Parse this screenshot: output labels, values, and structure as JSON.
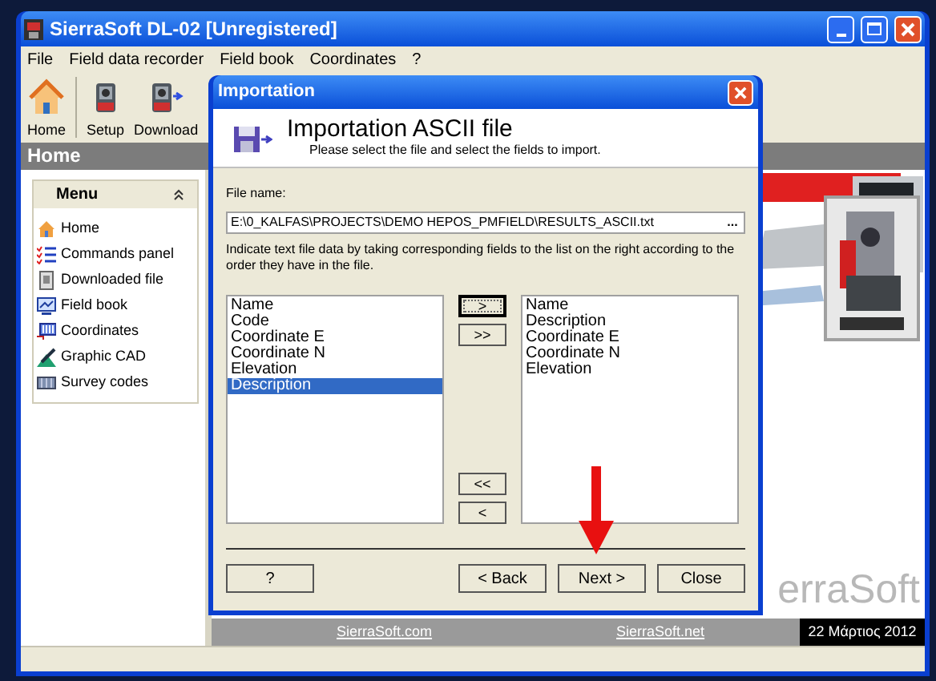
{
  "window": {
    "title": "SierraSoft DL-02 [Unregistered]"
  },
  "menu_bar": [
    "File",
    "Field data recorder",
    "Field book",
    "Coordinates",
    "?"
  ],
  "toolbar": [
    {
      "label": "Home",
      "kind": "home"
    },
    {
      "label": "Setup",
      "kind": "instrument"
    },
    {
      "label": "Download",
      "kind": "download"
    }
  ],
  "page_header": "Home",
  "sidebar": {
    "title": "Menu",
    "expanded": true,
    "items": [
      {
        "label": "Home",
        "kind": "home"
      },
      {
        "label": "Commands panel",
        "kind": "list"
      },
      {
        "label": "Downloaded file",
        "kind": "file"
      },
      {
        "label": "Field book",
        "kind": "book"
      },
      {
        "label": "Coordinates",
        "kind": "coords"
      },
      {
        "label": "Graphic CAD",
        "kind": "cad"
      },
      {
        "label": "Survey codes",
        "kind": "codes"
      }
    ]
  },
  "logo_text": "erraSoft",
  "footer": {
    "links": [
      "SierraSoft.com",
      "SierraSoft.net"
    ],
    "date": "22 Μάρτιος 2012"
  },
  "dialog": {
    "title": "Importation",
    "heading": "Importation ASCII file",
    "subtitle": "Please select the file and select the fields to import.",
    "file_label": "File name:",
    "file_value": "E:\\0_KALFAS\\PROJECTS\\DEMO HEPOS_PMFIELD\\RESULTS_ASCII.txt",
    "browse": "...",
    "instructions": "Indicate text file data by taking corresponding fields to the list on the right according to the order they have in the file.",
    "available_fields": [
      {
        "label": "Name",
        "selected": false
      },
      {
        "label": "Code",
        "selected": false
      },
      {
        "label": "Coordinate E",
        "selected": false
      },
      {
        "label": "Coordinate N",
        "selected": false
      },
      {
        "label": "Elevation",
        "selected": false
      },
      {
        "label": "Description",
        "selected": true
      }
    ],
    "chosen_fields": [
      {
        "label": "Name",
        "selected": false
      },
      {
        "label": "Description",
        "selected": false
      },
      {
        "label": "Coordinate E",
        "selected": false
      },
      {
        "label": "Coordinate N",
        "selected": false
      },
      {
        "label": "Elevation",
        "selected": false
      }
    ],
    "add_buttons": [
      {
        "label": ">",
        "focused": true
      },
      {
        "label": ">>",
        "focused": false
      }
    ],
    "remove_buttons": [
      {
        "label": "<<",
        "focused": false
      },
      {
        "label": "<",
        "focused": false
      }
    ],
    "buttons": [
      "?",
      "< Back",
      "Next >",
      "Close"
    ]
  }
}
